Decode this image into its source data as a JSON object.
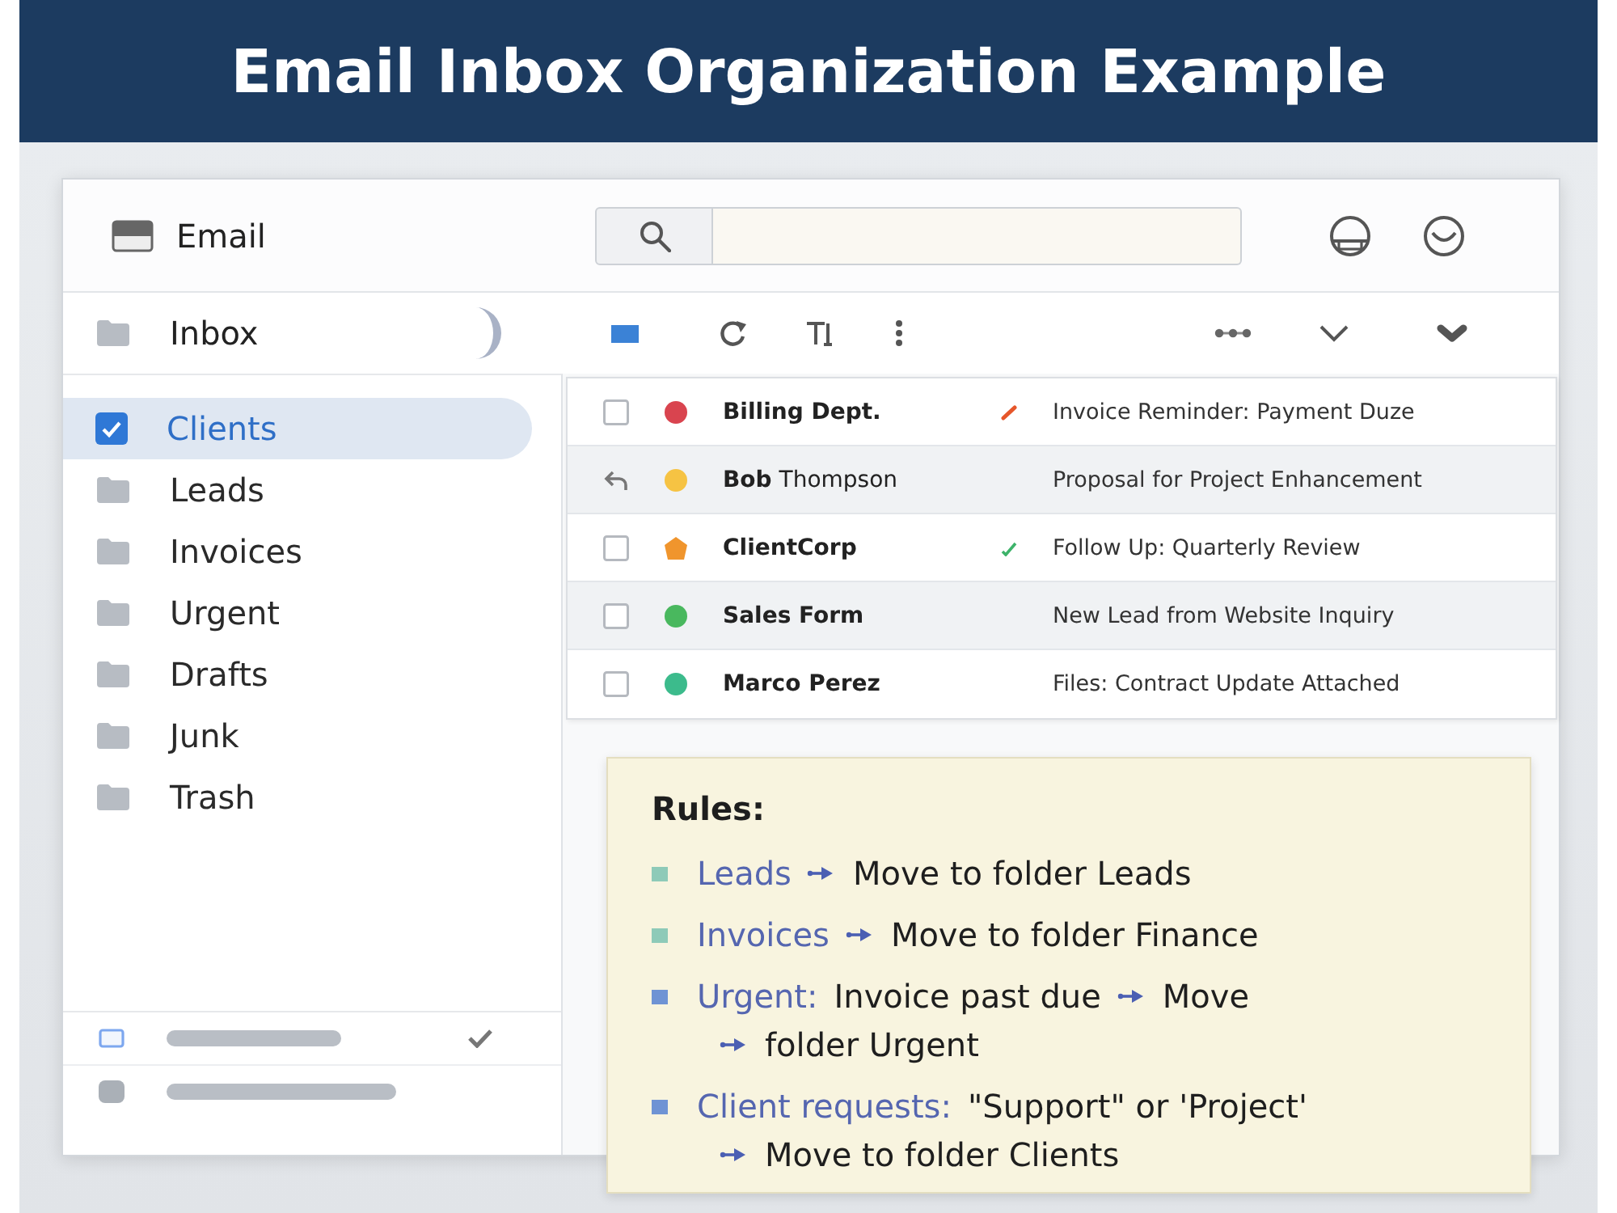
{
  "banner": {
    "title": "Email Inbox Organization Example"
  },
  "header": {
    "app_name": "Email"
  },
  "sidebar": {
    "inbox": {
      "label": "Inbox"
    },
    "folders": [
      {
        "label": "Clients",
        "selected": true
      },
      {
        "label": "Leads",
        "selected": false
      },
      {
        "label": "Invoices",
        "selected": false
      },
      {
        "label": "Urgent",
        "selected": false
      },
      {
        "label": "Drafts",
        "selected": false
      },
      {
        "label": "Junk",
        "selected": false
      },
      {
        "label": "Trash",
        "selected": false
      }
    ],
    "footer": [
      {
        "kind": "outline",
        "checked": true
      },
      {
        "kind": "filled",
        "checked": false
      }
    ]
  },
  "messages": [
    {
      "kind": "checkbox",
      "marker": {
        "kind": "circle",
        "color": "#d9444f"
      },
      "sender": "Billing Dept.",
      "bold": true,
      "flag": {
        "kind": "slash",
        "color": "#e6562a"
      },
      "subject": "Invoice Reminder: Payment Duze"
    },
    {
      "kind": "reply",
      "marker": {
        "kind": "circle",
        "color": "#f6c343"
      },
      "sender": "**Bob** Thompson",
      "bold": false,
      "subject": "Proposal for Project Enhancement"
    },
    {
      "kind": "checkbox",
      "marker": {
        "kind": "pentagon",
        "color": "#f0952d"
      },
      "sender": "ClientCorp",
      "bold": true,
      "flag": {
        "kind": "tick",
        "color": "#3db36a"
      },
      "subject": "Follow Up: Quarterly Review"
    },
    {
      "kind": "checkbox",
      "marker": {
        "kind": "circle",
        "color": "#49b85e"
      },
      "sender": "Sales Form",
      "bold": true,
      "subject": "New Lead from Website Inquiry"
    },
    {
      "kind": "checkbox",
      "marker": {
        "kind": "circle",
        "color": "#3cbb8c"
      },
      "sender": "Marco Perez",
      "bold": true,
      "subject": "Files: Contract Update Attached"
    }
  ],
  "rules": {
    "title": "Rules:",
    "items": [
      {
        "color": "#8ecab8",
        "lines": [
          [
            {
              "kind": "keyword",
              "text": "Leads"
            },
            {
              "kind": "arrow"
            },
            {
              "kind": "text",
              "text": "Move to folder Leads"
            }
          ]
        ]
      },
      {
        "color": "#8ecab8",
        "lines": [
          [
            {
              "kind": "keyword",
              "text": "Invoices"
            },
            {
              "kind": "arrow"
            },
            {
              "kind": "text",
              "text": "Move to folder Finance"
            }
          ]
        ]
      },
      {
        "color": "#6f93d4",
        "lines": [
          [
            {
              "kind": "keyword",
              "text": "Urgent:"
            },
            {
              "kind": "text",
              "text": "Invoice past due"
            },
            {
              "kind": "arrow"
            },
            {
              "kind": "text",
              "text": "Move"
            }
          ],
          [
            {
              "kind": "arrow"
            },
            {
              "kind": "text",
              "text": "folder Urgent"
            }
          ]
        ]
      },
      {
        "color": "#6f93d4",
        "lines": [
          [
            {
              "kind": "keyword",
              "text": "Client requests:"
            },
            {
              "kind": "text",
              "text": "\"Support\" or 'Project'"
            }
          ],
          [
            {
              "kind": "arrow"
            },
            {
              "kind": "text",
              "text": "Move to folder Clients"
            }
          ]
        ]
      }
    ]
  }
}
